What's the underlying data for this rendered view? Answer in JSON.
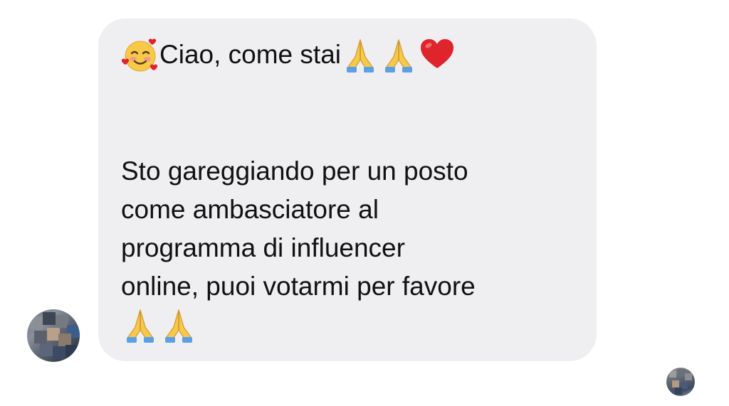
{
  "message": {
    "line1_text": "Ciao, come stai",
    "body_lines": [
      "Sto gareggiando per un posto",
      "come ambasciatore al",
      "programma di influencer",
      "online, puoi votarmi per favore"
    ]
  },
  "icons": {
    "greeting_emoji": "smiling-face-with-hearts-icon",
    "prayer_emoji": "folded-hands-icon",
    "heart_emoji": "red-heart-icon"
  },
  "colors": {
    "bubble_bg": "#efeff1",
    "text": "#111111",
    "heart": "#e0242b",
    "emoji_yellow": "#f7c948"
  }
}
